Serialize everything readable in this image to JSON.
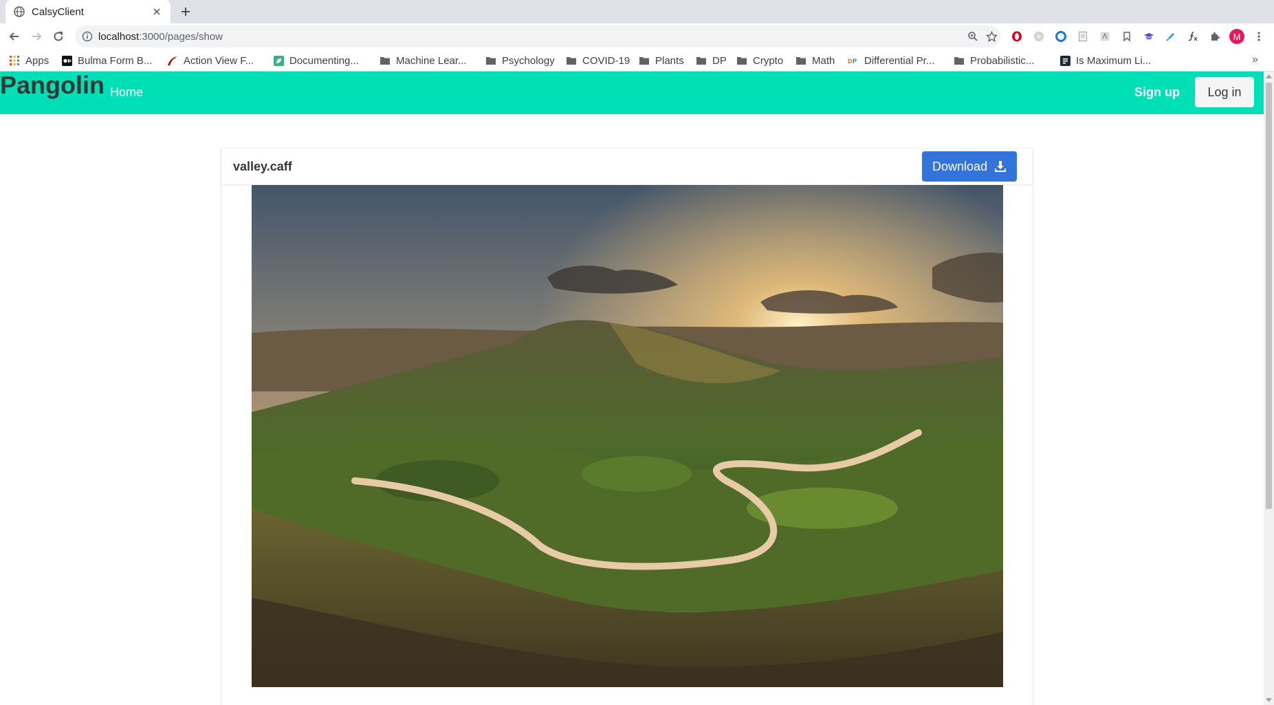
{
  "browser": {
    "tab_title": "CalsyClient",
    "url_host": "localhost",
    "url_rest": ":3000/pages/show",
    "avatar_letter": "M",
    "bookmarks": [
      {
        "label": "Apps",
        "icon": "apps-grid-icon"
      },
      {
        "label": "Bulma Form B...",
        "icon": "medium-logo-icon"
      },
      {
        "label": "Action View F...",
        "icon": "rails-logo-icon"
      },
      {
        "label": "Documenting...",
        "icon": "leaf-logo-icon"
      },
      {
        "label": "Machine Lear...",
        "icon": "folder-icon"
      },
      {
        "label": "Psychology",
        "icon": "folder-icon"
      },
      {
        "label": "COVID-19",
        "icon": "folder-icon"
      },
      {
        "label": "Plants",
        "icon": "folder-icon"
      },
      {
        "label": "DP",
        "icon": "folder-icon"
      },
      {
        "label": "Crypto",
        "icon": "folder-icon"
      },
      {
        "label": "Math",
        "icon": "folder-icon"
      },
      {
        "label": "Differential Pr...",
        "icon": "dp-logo-icon"
      },
      {
        "label": "Probabilistic...",
        "icon": "folder-icon"
      },
      {
        "label": "Is Maximum Li...",
        "icon": "stackexchange-logo-icon"
      }
    ]
  },
  "navbar": {
    "brand": "Pangolin",
    "home": "Home",
    "signup": "Sign up",
    "login": "Log in",
    "color": "#00e0b7"
  },
  "card": {
    "title": "valley.caff",
    "download_label": "Download",
    "download_color": "#3273dc",
    "image_description_icon": "landscape-photo"
  }
}
